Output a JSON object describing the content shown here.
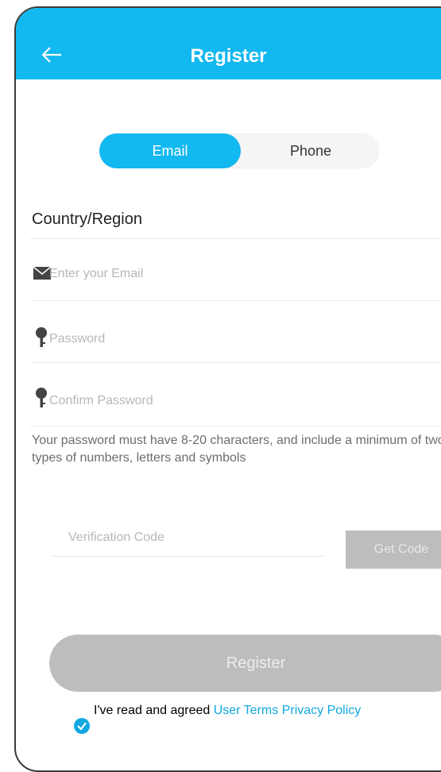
{
  "header": {
    "title": "Register",
    "back_icon": "arrow-left-icon"
  },
  "tabs": [
    {
      "label": "Email",
      "active": true
    },
    {
      "label": "Phone",
      "active": false
    }
  ],
  "form": {
    "country_label": "Country/Region",
    "email_placeholder": "Enter your Email",
    "password_placeholder": "Password",
    "confirm_placeholder": "Confirm Password",
    "help_text": "Your password must have 8-20 characters, and include a minimum of two types of numbers, letters and symbols",
    "code_placeholder": "Verification Code",
    "get_code_label": "Get Code"
  },
  "footer": {
    "register_label": "Register",
    "agree_text": "I've read and agreed",
    "user_terms": "User Terms",
    "privacy_policy": "Privacy Policy"
  },
  "colors": {
    "accent": "#12b8f0",
    "disabled": "#bdbdbd",
    "link": "#12a7e0"
  }
}
